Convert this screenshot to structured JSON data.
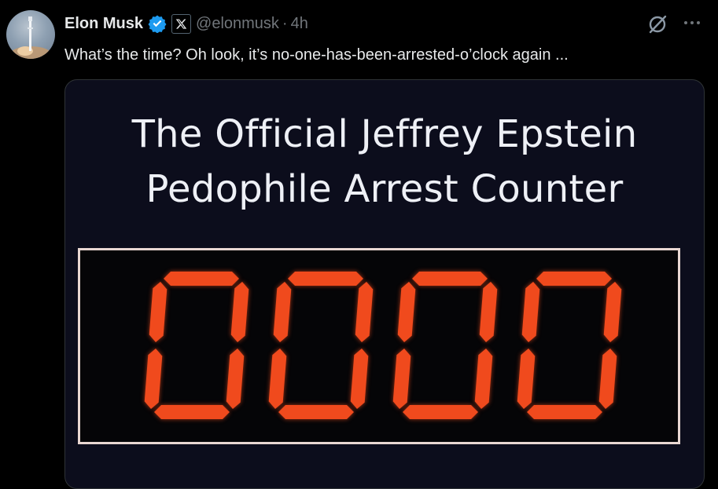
{
  "tweet": {
    "author_name": "Elon Musk",
    "handle": "@elonmusk",
    "separator": "·",
    "time": "4h",
    "text": "What’s the time? Oh look, it’s no-one-has-been-arrested-o’clock again ..."
  },
  "icons": {
    "verified": "verified-badge-icon",
    "affiliate": "x-logo-icon",
    "grok": "grok-icon",
    "more": "more-options-icon"
  },
  "colors": {
    "background": "#000000",
    "text_primary": "#e7e9ea",
    "text_secondary": "#71767b",
    "verified": "#1d9bf0",
    "segment": "#f04a1d"
  },
  "media": {
    "title_line1": "The Official Jeffrey Epstein",
    "title_line2": "Pedophile Arrest Counter",
    "counter_value": "0000"
  }
}
